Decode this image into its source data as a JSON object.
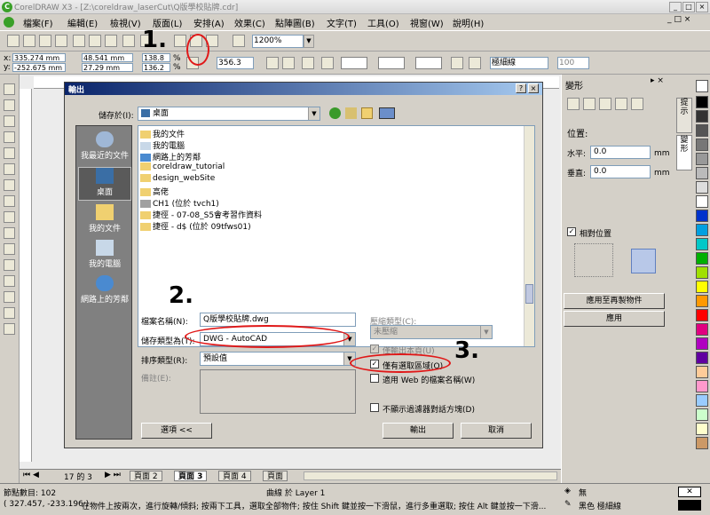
{
  "app": {
    "title": "CorelDRAW X3 - [Z:\\coreldraw_laserCut\\Q版學校貼牌.cdr]"
  },
  "menu": [
    "檔案(F)",
    "編輯(E)",
    "檢視(V)",
    "版面(L)",
    "安排(A)",
    "效果(C)",
    "點陣圖(B)",
    "文字(T)",
    "工具(O)",
    "視窗(W)",
    "說明(H)"
  ],
  "toolbar": {
    "zoom": "1200%"
  },
  "property_bar": {
    "x": "335.274 mm",
    "y": "-252.675 mm",
    "w": "48.541 mm",
    "h": "27.29 mm",
    "sx": "138.8",
    "sy": "136.2",
    "unit": "%",
    "angle": "356.3",
    "outline": "極細線",
    "opacity": "100"
  },
  "dialog": {
    "title": "輸出",
    "save_in_label": "儲存於(I):",
    "save_in_value": "桌面",
    "places": [
      "我最近的文件",
      "桌面",
      "我的文件",
      "我的電腦",
      "網路上的芳鄰"
    ],
    "files": [
      "我的文件",
      "我的電腦",
      "網路上的芳鄰",
      "coreldraw_tutorial",
      "design_webSite",
      "高佬",
      "CH1 (位於 tvch1)",
      "捷徑 - 07-08_S5會考習作資料",
      "捷徑 - d$ (位於 09tfws01)"
    ],
    "filename_label": "檔案名稱(N):",
    "filename_value": "Q版學校貼牌.dwg",
    "type_label": "儲存類型為(T):",
    "type_value": "DWG - AutoCAD",
    "sort_label": "排序類型(R):",
    "sort_value": "預設值",
    "notes_label": "備註(E):",
    "compress_label": "壓縮類型(C):",
    "compress_value": "未壓縮",
    "opt_page": "僅輸出本頁(U)",
    "opt_selected": "僅有選取區域(O)",
    "opt_web": "適用 Web 的檔案名稱(W)",
    "opt_nodialog": "不顯示過濾器對話方塊(D)",
    "options_button": "選項 <<",
    "export_button": "輸出",
    "cancel_button": "取消"
  },
  "annotations": [
    "1.",
    "2.",
    "3."
  ],
  "docker": {
    "title": "變形",
    "position_label": "位置:",
    "h_label": "水平:",
    "h_value": "0.0",
    "v_label": "垂直:",
    "v_value": "0.0",
    "unit": "mm",
    "relative_label": "相對位置",
    "apply_copy": "應用至再製物件",
    "apply": "應用",
    "tab1": "提示",
    "tab2": "變形"
  },
  "page_tabs": {
    "counter": "17 的 3",
    "tabs": [
      "頁面 2",
      "頁面 3",
      "頁面 4",
      "頁面"
    ]
  },
  "status": {
    "nodes": "節點數目: 102",
    "layer": "曲線 於 Layer 1",
    "coords": "( 327.457, -233.196 )",
    "hint": "在物件上按兩次，進行旋轉/傾斜; 按兩下工具，選取全部物件; 按住 Shift 鍵並按一下滑鼠，進行多重選取; 按住 Alt 鍵並按一下滑...",
    "fill": "無",
    "outline": "黑色  極細線"
  },
  "colors": {
    "accent": "#0a246a",
    "annotation": "#e01818"
  }
}
